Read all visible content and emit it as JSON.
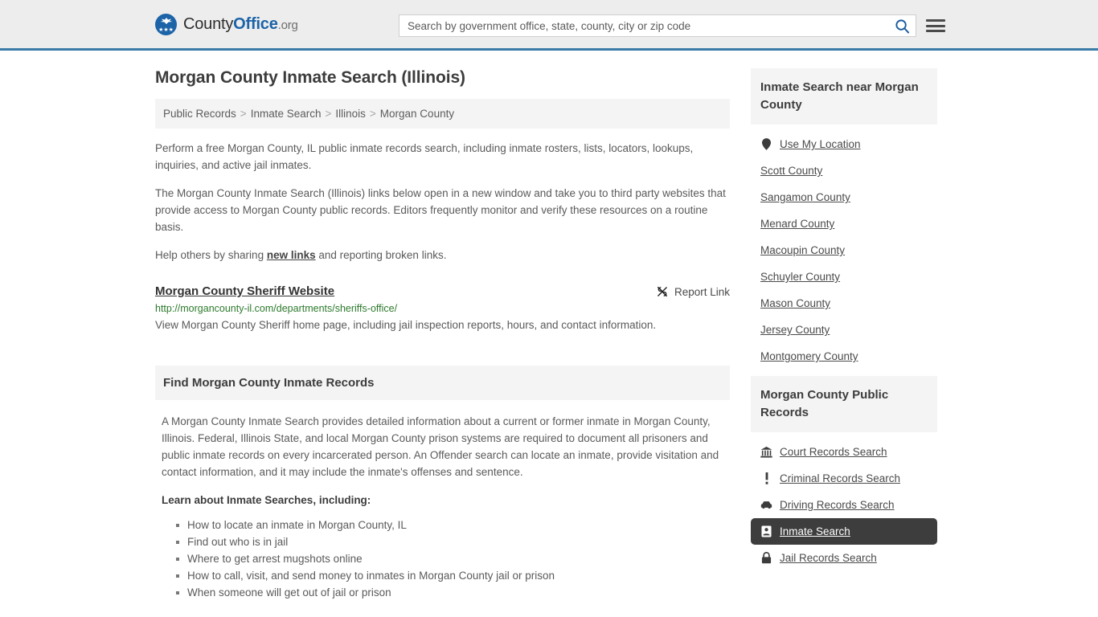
{
  "header": {
    "brand": {
      "part1": "County",
      "part2": "Office",
      "part3": ".org",
      "mark_icon": "eagle-seal-icon"
    },
    "search": {
      "placeholder": "Search by government office, state, county, city or zip code",
      "value": "",
      "search_icon": "search-icon"
    },
    "menu_icon": "hamburger-menu-icon",
    "accent_color": "#1c63a8",
    "border_color": "#3b7ba8"
  },
  "main": {
    "title": "Morgan County Inmate Search (Illinois)",
    "breadcrumb": [
      {
        "label": "Public Records"
      },
      {
        "label": "Inmate Search"
      },
      {
        "label": "Illinois"
      },
      {
        "label": "Morgan County"
      }
    ],
    "breadcrumb_separator": ">",
    "intro_1": "Perform a free Morgan County, IL public inmate records search, including inmate rosters, lists, locators, lookups, inquiries, and active jail inmates.",
    "intro_2": "The Morgan County Inmate Search (Illinois) links below open in a new window and take you to third party websites that provide access to Morgan County public records. Editors frequently monitor and verify these resources on a routine basis.",
    "help_prefix": "Help others by sharing ",
    "help_link": "new links",
    "help_suffix": " and reporting broken links.",
    "entry": {
      "title": "Morgan County Sheriff Website",
      "report_label": "Report Link",
      "report_icon": "broken-link-icon",
      "url": "http://morgancounty-il.com/departments/sheriffs-office/",
      "description": "View Morgan County Sheriff home page, including jail inspection reports, hours, and contact information.",
      "url_color": "#2c7a2c"
    },
    "section": {
      "heading": "Find Morgan County Inmate Records",
      "paragraph": "A Morgan County Inmate Search provides detailed information about a current or former inmate in Morgan County, Illinois. Federal, Illinois State, and local Morgan County prison systems are required to document all prisoners and public inmate records on every incarcerated person. An Offender search can locate an inmate, provide visitation and contact information, and it may include the inmate's offenses and sentence.",
      "list_lead": "Learn about Inmate Searches, including:",
      "bullets": [
        "How to locate an inmate in Morgan County, IL",
        "Find out who is in jail",
        "Where to get arrest mugshots online",
        "How to call, visit, and send money to inmates in Morgan County jail or prison",
        "When someone will get out of jail or prison"
      ]
    }
  },
  "sidebar": {
    "nearby": {
      "heading": "Inmate Search near Morgan County",
      "items": [
        {
          "label": "Use My Location",
          "icon": "map-pin-icon"
        },
        {
          "label": "Scott County",
          "icon": ""
        },
        {
          "label": "Sangamon County",
          "icon": ""
        },
        {
          "label": "Menard County",
          "icon": ""
        },
        {
          "label": "Macoupin County",
          "icon": ""
        },
        {
          "label": "Schuyler County",
          "icon": ""
        },
        {
          "label": "Mason County",
          "icon": ""
        },
        {
          "label": "Jersey County",
          "icon": ""
        },
        {
          "label": "Montgomery County",
          "icon": ""
        }
      ]
    },
    "records": {
      "heading": "Morgan County Public Records",
      "active_bg": "#3d3d3d",
      "items": [
        {
          "label": "Court Records Search",
          "icon": "courthouse-icon",
          "active": false
        },
        {
          "label": "Criminal Records Search",
          "icon": "exclamation-icon",
          "active": false
        },
        {
          "label": "Driving Records Search",
          "icon": "car-icon",
          "active": false
        },
        {
          "label": "Inmate Search",
          "icon": "id-badge-icon",
          "active": true
        },
        {
          "label": "Jail Records Search",
          "icon": "lock-icon",
          "active": false
        }
      ]
    }
  }
}
